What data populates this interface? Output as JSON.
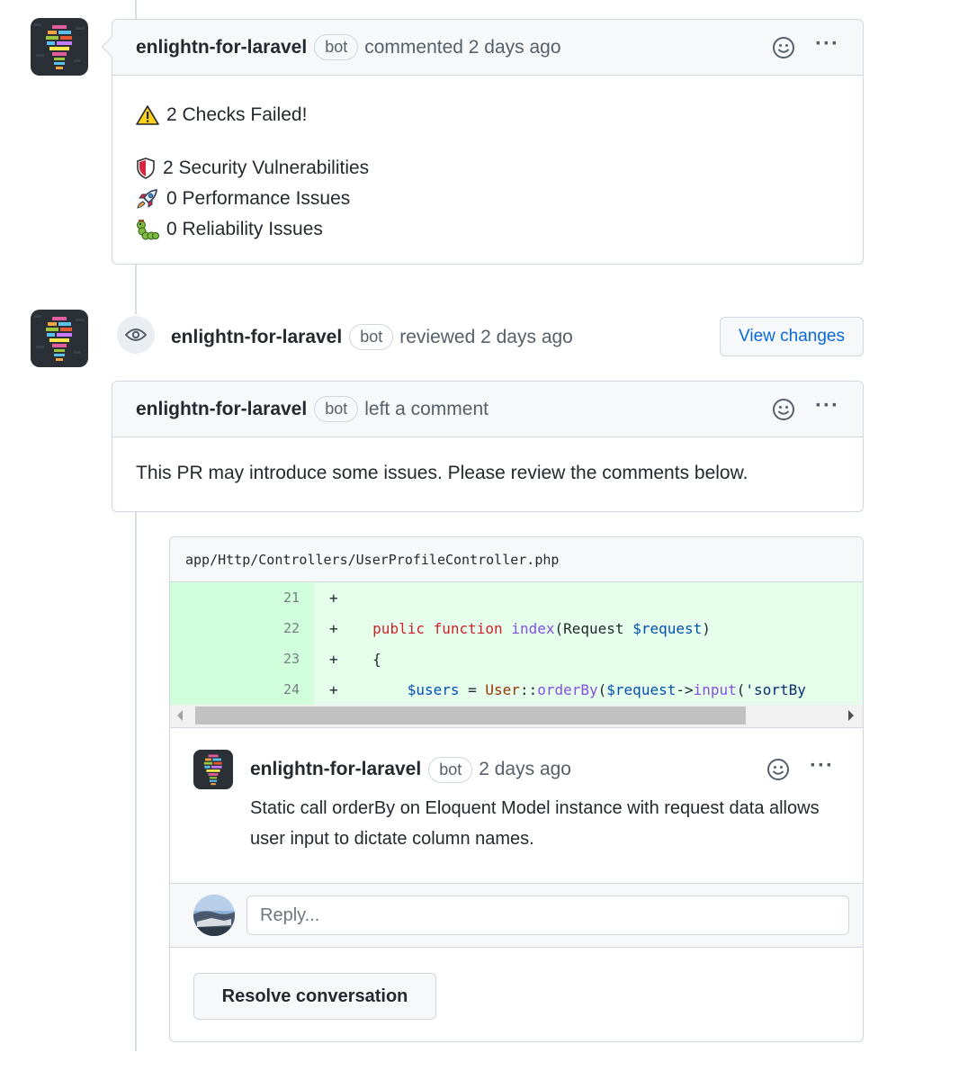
{
  "comment1": {
    "author": "enlightn-for-laravel",
    "badge": "bot",
    "action": "commented 2 days ago",
    "title": "2 Checks Failed!",
    "items": [
      {
        "icon": "shield-icon",
        "text": "2 Security Vulnerabilities"
      },
      {
        "icon": "rocket-icon",
        "text": "0 Performance Issues"
      },
      {
        "icon": "caterpillar-icon",
        "text": "0 Reliability Issues"
      }
    ]
  },
  "review": {
    "author": "enlightn-for-laravel",
    "badge": "bot",
    "action": "reviewed 2 days ago",
    "view_changes_label": "View changes",
    "comment_author": "enlightn-for-laravel",
    "comment_badge": "bot",
    "comment_action": "left a comment",
    "comment_text": "This PR may introduce some issues. Please review the comments below."
  },
  "thread": {
    "file_path": "app/Http/Controllers/UserProfileController.php",
    "lines": [
      {
        "number": "21",
        "sign": "+"
      },
      {
        "number": "22",
        "sign": "+"
      },
      {
        "number": "23",
        "sign": "+"
      },
      {
        "number": "24",
        "sign": "+"
      }
    ],
    "comment_author": "enlightn-for-laravel",
    "comment_badge": "bot",
    "comment_time": "2 days ago",
    "comment_text": "Static call orderBy on Eloquent Model instance with request data allows user input to dictate column names.",
    "reply_placeholder": "Reply...",
    "resolve_label": "Resolve conversation"
  },
  "colors": {
    "added_line_bg": "#e6ffec",
    "added_gutter_bg": "#ccffd8",
    "link": "#0969da",
    "border": "#d0d7de"
  }
}
